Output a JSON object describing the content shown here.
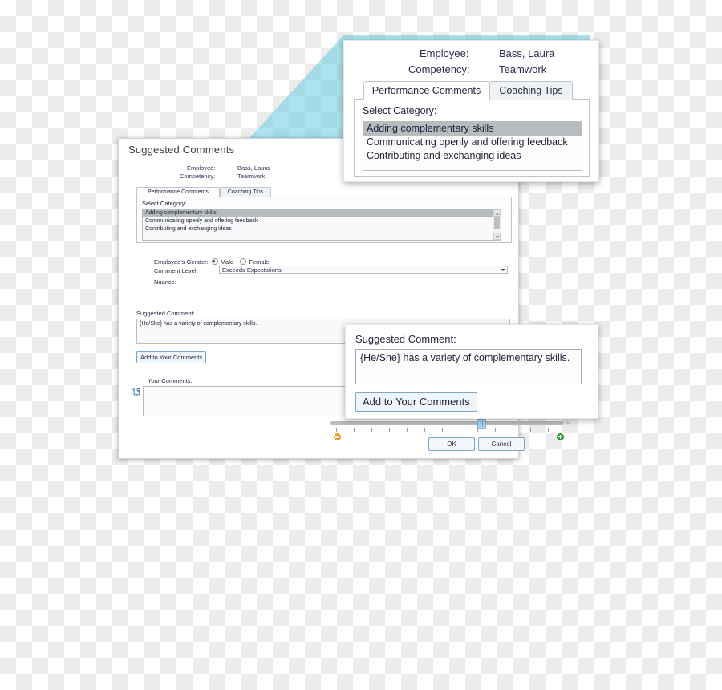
{
  "main_dialog": {
    "title": "Suggested Comments",
    "employee_label": "Employee:",
    "employee_value": "Bass, Laura",
    "competency_label": "Competency:",
    "competency_value": "Teamwork",
    "tabs": [
      {
        "label": "Performance Comments",
        "active": true
      },
      {
        "label": "Coaching Tips",
        "active": false
      }
    ],
    "select_category_label": "Select Category:",
    "categories": [
      "Adding complementary skills",
      "Communicating openly and offering feedback",
      "Contributing and exchanging ideas"
    ],
    "selected_category": "Adding complementary skills",
    "gender_label": "Employee's Gender:",
    "gender_options": [
      "Male",
      "Female"
    ],
    "gender_selected": "Male",
    "comment_level_label": "Comment Level:",
    "comment_level_value": "Exceeds Expectations",
    "nuance_label": "Nuance:",
    "nuance_minus_icon": "minus-circle-icon",
    "nuance_plus_icon": "plus-circle-icon",
    "nuance_ticks": 14,
    "nuance_value_percent": 64,
    "suggested_comment_label": "Suggested Comment:",
    "suggested_comment_text": "{He/She} has a variety of complementary skills.",
    "add_button_label": "Add to Your Comments",
    "your_comments_label": "Your Comments:",
    "your_comments_text": "",
    "paste_icon": "paste-clipboard-icon",
    "ok_label": "OK",
    "cancel_label": "Cancel",
    "scrollbar": {
      "up_icon": "scroll-up-arrow-icon",
      "down_icon": "scroll-down-arrow-icon"
    }
  },
  "callout_top": {
    "employee_label": "Employee:",
    "employee_value": "Bass, Laura",
    "competency_label": "Competency:",
    "competency_value": "Teamwork",
    "tabs": [
      {
        "label": "Performance Comments",
        "active": true
      },
      {
        "label": "Coaching Tips",
        "active": false
      }
    ],
    "select_category_label": "Select Category:",
    "categories": [
      "Adding complementary skills",
      "Communicating openly and offering feedback",
      "Contributing and exchanging ideas"
    ]
  },
  "callout_bottom": {
    "label": "Suggested Comment:",
    "text": "{He/She} has a variety of complementary skills.",
    "button_label": "Add to Your Comments"
  },
  "colors": {
    "beam": "#74d1e4",
    "accent_blue": "#7ba7cf",
    "minus_orange": "#f2981f",
    "plus_green": "#2e9b2e",
    "selection_gray": "#b9bcbe"
  }
}
